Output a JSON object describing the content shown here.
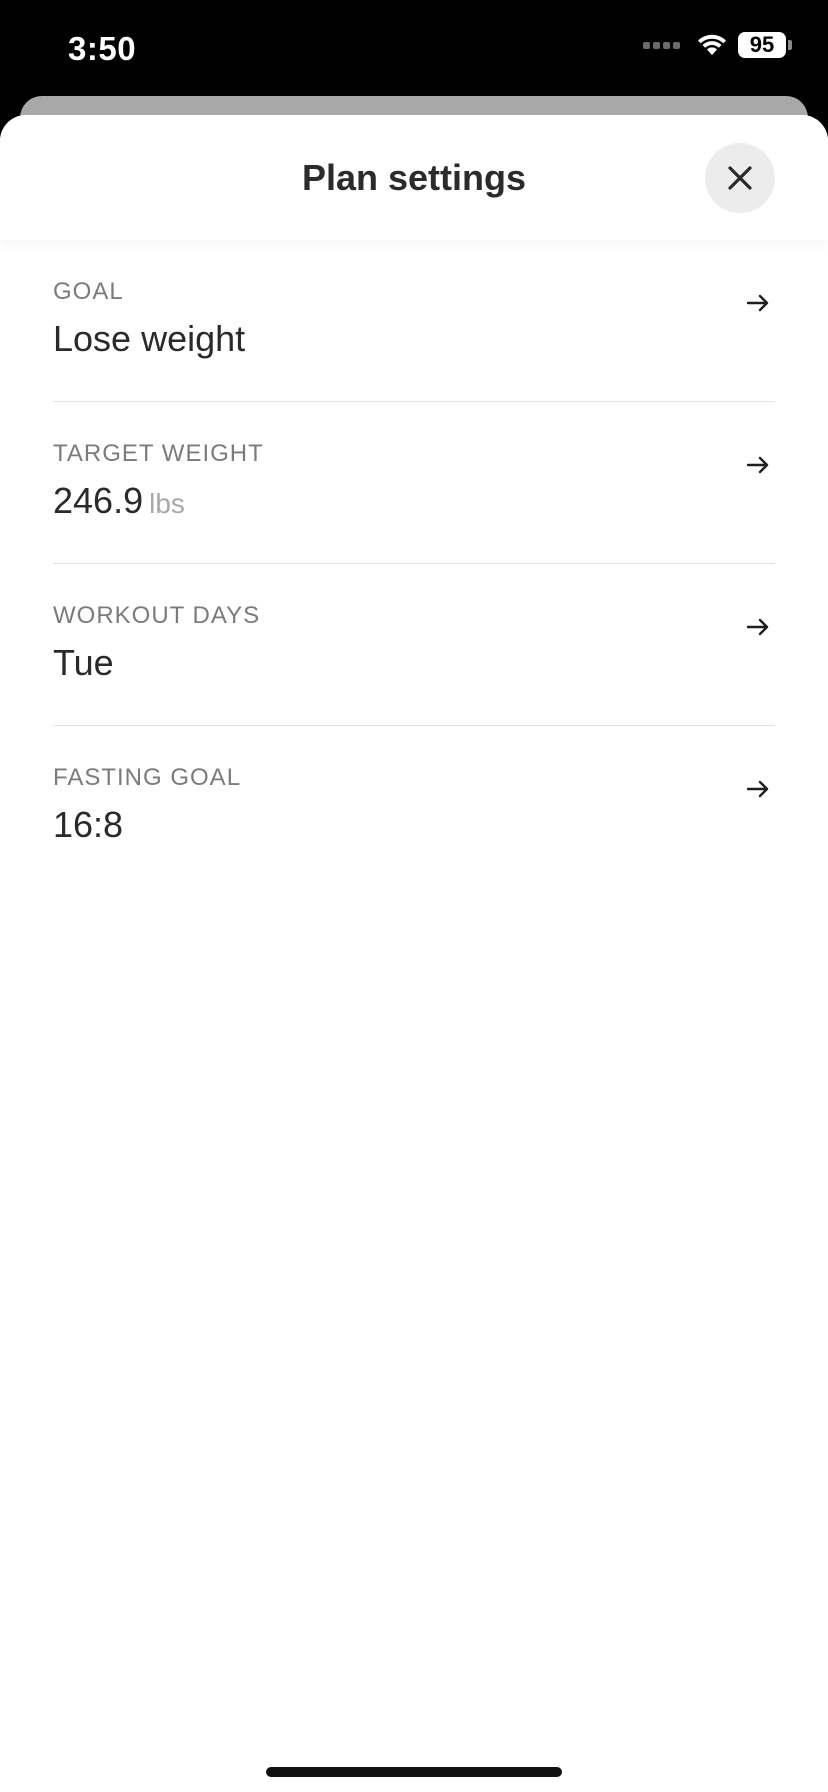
{
  "status_bar": {
    "time": "3:50",
    "battery": "95",
    "icons": [
      "cellular-signal-icon",
      "wifi-icon",
      "battery-icon"
    ]
  },
  "header": {
    "title": "Plan settings",
    "close_icon": "close-icon"
  },
  "settings": [
    {
      "label": "GOAL",
      "value": "Lose weight",
      "unit": ""
    },
    {
      "label": "TARGET WEIGHT",
      "value": "246.9",
      "unit": "lbs"
    },
    {
      "label": "WORKOUT DAYS",
      "value": "Tue",
      "unit": ""
    },
    {
      "label": "FASTING GOAL",
      "value": "16:8",
      "unit": ""
    }
  ],
  "colors": {
    "background": "#ffffff",
    "status_bar": "#000000",
    "label": "#7b7b7b",
    "value": "#2a2a2a",
    "unit": "#a8a8a8",
    "divider": "#e3e3e3",
    "close_button_bg": "#ececec"
  }
}
